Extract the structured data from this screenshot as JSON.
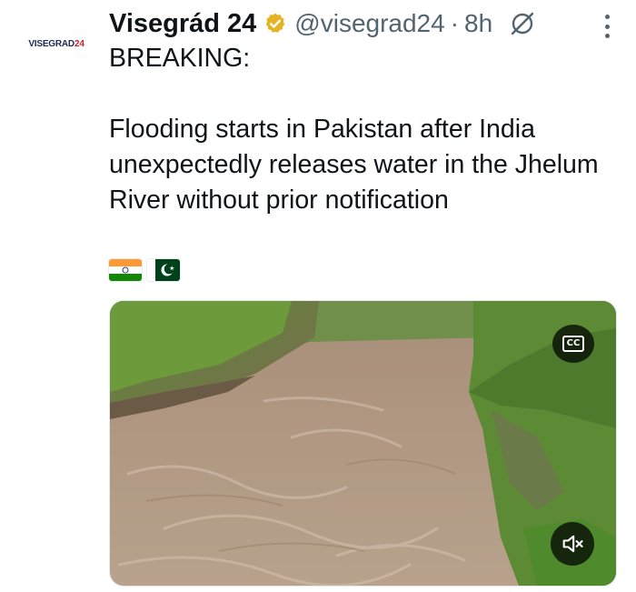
{
  "author": {
    "avatar_text_main": "VISEGRAD",
    "avatar_text_accent": "24",
    "display_name": "Visegrád 24",
    "handle": "@visegrad24",
    "separator": "·",
    "time": "8h",
    "verified_badge_color": "#e6b422"
  },
  "tweet": {
    "line1": "BREAKING:",
    "line2": "Flooding starts in Pakistan after India unexpectedly releases water in the Jhelum River without prior notification",
    "flags": [
      "india-flag",
      "pakistan-flag"
    ]
  },
  "media": {
    "cc_label": "CC",
    "icons": [
      "cc-icon",
      "muted-speaker-icon"
    ]
  },
  "icons": {
    "grok": "grok-icon",
    "more": "more-vertical-icon"
  }
}
